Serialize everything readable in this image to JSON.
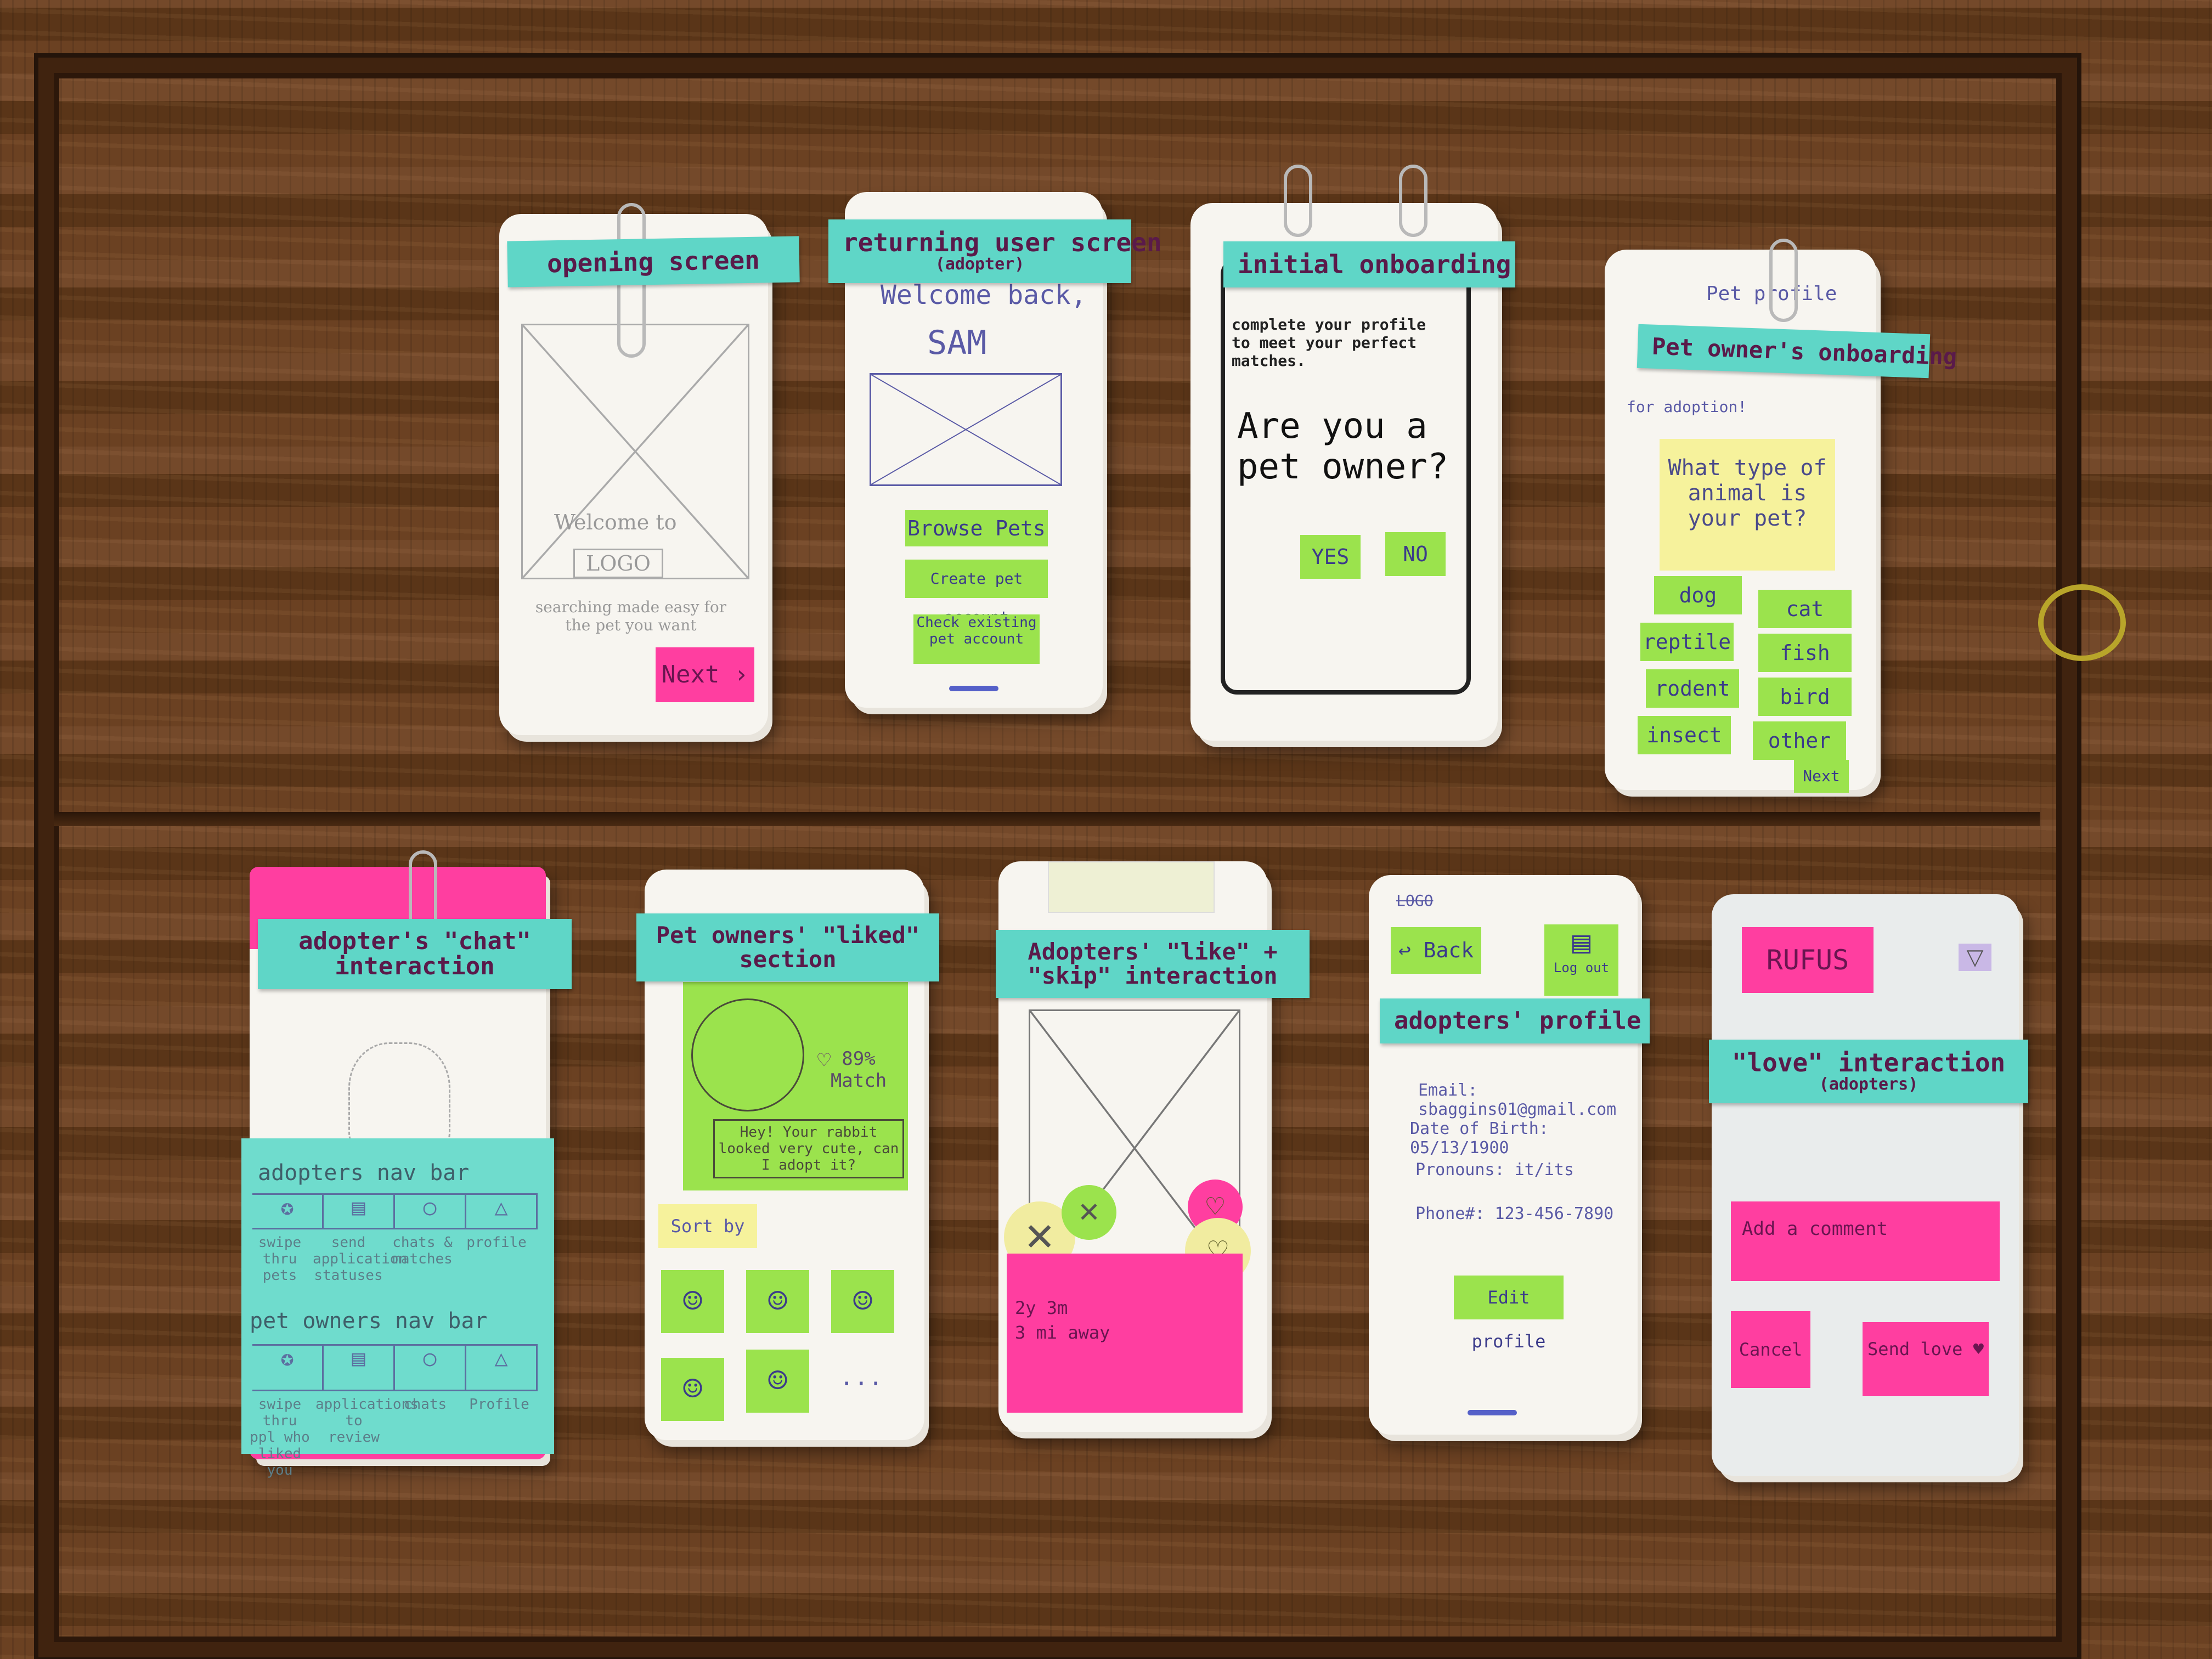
{
  "cards": {
    "opening": {
      "tape": "opening screen",
      "welcome": "Welcome to",
      "logo": "LOGO",
      "tagline": "searching made easy for the pet you want",
      "next": "Next"
    },
    "returning": {
      "tape": "returning user screen",
      "tape_sub": "(adopter)",
      "welcome": "Welcome back,",
      "name": "SAM",
      "btn_browse": "Browse Pets",
      "btn_create": "Create pet account",
      "btn_check": "Check existing pet account"
    },
    "initial": {
      "tape": "initial onboarding",
      "subtitle": "complete your profile to meet your perfect matches.",
      "question": "Are you a pet owner?",
      "yes": "YES",
      "no": "NO"
    },
    "owner_onboarding": {
      "tape": "Pet owner's onboarding",
      "header": "Pet profile",
      "adoption": "for adoption!",
      "question": "What type of animal is your pet?",
      "options": [
        "dog",
        "cat",
        "reptile",
        "fish",
        "rodent",
        "bird",
        "insect",
        "other"
      ],
      "next": "Next"
    },
    "chat": {
      "tape": "adopter's \"chat\" interaction",
      "adopters_nav_title": "adopters nav bar",
      "adopters_nav_labels": [
        "swipe thru pets",
        "send application statuses",
        "chats & matches",
        "profile"
      ],
      "owners_nav_title": "pet owners nav bar",
      "owners_nav_labels": [
        "swipe thru ppl who liked you",
        "applications to review",
        "chats",
        "Profile"
      ]
    },
    "liked": {
      "tape": "Pet owners' \"liked\" section",
      "match": "89% Match",
      "message": "Hey! Your rabbit looked very cute, can I adopt it?",
      "sort": "Sort by",
      "more": "..."
    },
    "like_skip": {
      "tape": "Adopters' \"like\" + \"skip\" interaction",
      "info": [
        "2y 3m",
        "3 mi away"
      ]
    },
    "profile": {
      "tape": "adopters' profile",
      "back": "Back",
      "logout": "Log out",
      "email": "Email: sbaggins01@gmail.com",
      "dob": "Date of Birth: 05/13/1900",
      "pronouns": "Pronouns: it/its",
      "phone": "Phone#: 123-456-7890",
      "edit": "Edit profile",
      "logo": "LOGO"
    },
    "love": {
      "tape": "\"love\" interaction",
      "tape_sub": "(adopters)",
      "name": "RUFUS",
      "comment": "Add a comment",
      "cancel": "Cancel",
      "send": "Send love"
    }
  }
}
